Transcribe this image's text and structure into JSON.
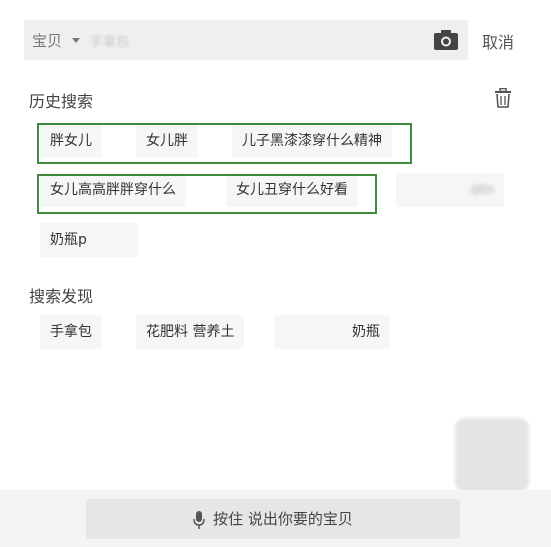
{
  "search": {
    "scope_label": "宝贝",
    "placeholder": "手拿包",
    "cancel_label": "取消"
  },
  "history": {
    "title": "历史搜索",
    "items": [
      "胖女儿",
      "女儿胖",
      "儿子黑漆漆穿什么精神",
      "女儿高高胖胖穿什么",
      "女儿丑穿什么好看",
      "otn",
      "奶瓶p"
    ]
  },
  "discover": {
    "title": "搜索发现",
    "items": [
      "手拿包",
      "花肥料 营养土",
      "奶瓶"
    ]
  },
  "voice": {
    "label": "按住 说出你要的宝贝"
  },
  "colors": {
    "highlight_box": "#3d8a3d",
    "chip_bg": "#f6f6f6",
    "search_bg": "#efefef"
  },
  "icons": [
    "chevron-down-icon",
    "camera-icon",
    "trash-icon",
    "microphone-icon"
  ]
}
